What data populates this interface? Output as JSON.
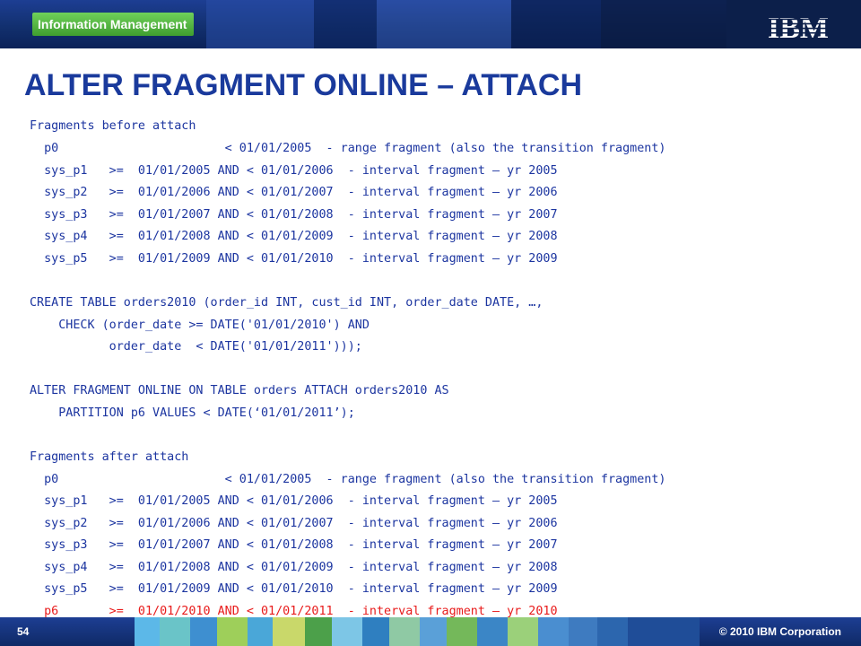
{
  "header": {
    "brand_label": "Information Management",
    "logo_text": "IBM"
  },
  "title": "ALTER FRAGMENT ONLINE – ATTACH",
  "code_lines": [
    {
      "text": "Fragments before attach",
      "color": "blue"
    },
    {
      "text": "  p0                       < 01/01/2005  - range fragment (also the transition fragment)",
      "color": "blue"
    },
    {
      "text": "  sys_p1   >=  01/01/2005 AND < 01/01/2006  - interval fragment – yr 2005",
      "color": "blue"
    },
    {
      "text": "  sys_p2   >=  01/01/2006 AND < 01/01/2007  - interval fragment – yr 2006",
      "color": "blue"
    },
    {
      "text": "  sys_p3   >=  01/01/2007 AND < 01/01/2008  - interval fragment – yr 2007",
      "color": "blue"
    },
    {
      "text": "  sys_p4   >=  01/01/2008 AND < 01/01/2009  - interval fragment – yr 2008",
      "color": "blue"
    },
    {
      "text": "  sys_p5   >=  01/01/2009 AND < 01/01/2010  - interval fragment – yr 2009",
      "color": "blue"
    },
    {
      "text": "CREATE TABLE orders2010 (order_id INT, cust_id INT, order_date DATE, …,",
      "color": "blue"
    },
    {
      "text": "    CHECK (order_date >= DATE('01/01/2010') AND",
      "color": "blue"
    },
    {
      "text": "           order_date  < DATE('01/01/2011')));",
      "color": "blue"
    },
    {
      "text": "ALTER FRAGMENT ONLINE ON TABLE orders ATTACH orders2010 AS",
      "color": "blue"
    },
    {
      "text": "    PARTITION p6 VALUES < DATE(‘01/01/2011’);",
      "color": "blue"
    },
    {
      "text": "Fragments after attach",
      "color": "blue"
    },
    {
      "text": "  p0                       < 01/01/2005  - range fragment (also the transition fragment)",
      "color": "blue"
    },
    {
      "text": "  sys_p1   >=  01/01/2005 AND < 01/01/2006  - interval fragment – yr 2005",
      "color": "blue"
    },
    {
      "text": "  sys_p2   >=  01/01/2006 AND < 01/01/2007  - interval fragment – yr 2006",
      "color": "blue"
    },
    {
      "text": "  sys_p3   >=  01/01/2007 AND < 01/01/2008  - interval fragment – yr 2007",
      "color": "blue"
    },
    {
      "text": "  sys_p4   >=  01/01/2008 AND < 01/01/2009  - interval fragment – yr 2008",
      "color": "blue"
    },
    {
      "text": "  sys_p5   >=  01/01/2009 AND < 01/01/2010  - interval fragment – yr 2009",
      "color": "blue"
    },
    {
      "text": "  p6       >=  01/01/2010 AND < 01/01/2011  - interval fragment – yr 2010",
      "color": "red"
    }
  ],
  "footer": {
    "page_number": "54",
    "copyright": "© 2010 IBM Corporation"
  },
  "colors": {
    "title": "#1a3a9c",
    "code": "#1c35a0",
    "highlight": "#e81b1b",
    "banner": "#12306f",
    "badge": "#4caf3a"
  }
}
